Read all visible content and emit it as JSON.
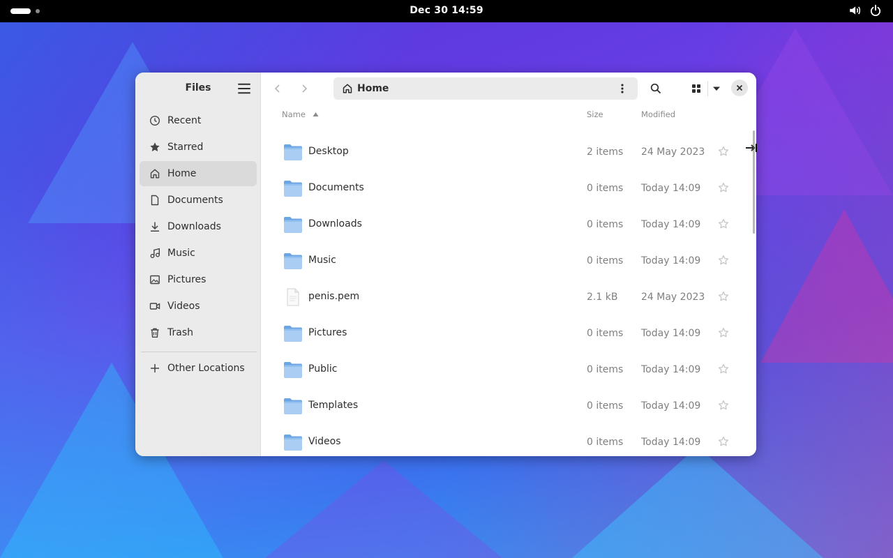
{
  "topbar": {
    "clock": "Dec 30  14:59",
    "icons": [
      "activities-indicator",
      "volume-icon",
      "power-icon"
    ]
  },
  "sidebar": {
    "title": "Files",
    "items": [
      {
        "label": "Recent",
        "icon": "clock-icon"
      },
      {
        "label": "Starred",
        "icon": "star-icon"
      },
      {
        "label": "Home",
        "icon": "home-icon",
        "active": true
      },
      {
        "label": "Documents",
        "icon": "document-icon"
      },
      {
        "label": "Downloads",
        "icon": "download-icon"
      },
      {
        "label": "Music",
        "icon": "music-icon"
      },
      {
        "label": "Pictures",
        "icon": "picture-icon"
      },
      {
        "label": "Videos",
        "icon": "video-icon"
      },
      {
        "label": "Trash",
        "icon": "trash-icon"
      }
    ],
    "other_locations": "Other Locations"
  },
  "header": {
    "path": "Home"
  },
  "columns": {
    "name": "Name",
    "size": "Size",
    "modified": "Modified"
  },
  "files": [
    {
      "name": "Desktop",
      "size": "2 items",
      "modified": "24 May 2023",
      "type": "folder"
    },
    {
      "name": "Documents",
      "size": "0 items",
      "modified": "Today 14:09",
      "type": "folder"
    },
    {
      "name": "Downloads",
      "size": "0 items",
      "modified": "Today 14:09",
      "type": "folder"
    },
    {
      "name": "Music",
      "size": "0 items",
      "modified": "Today 14:09",
      "type": "folder"
    },
    {
      "name": "penis.pem",
      "size": "2.1 kB",
      "modified": "24 May 2023",
      "type": "file"
    },
    {
      "name": "Pictures",
      "size": "0 items",
      "modified": "Today 14:09",
      "type": "folder"
    },
    {
      "name": "Public",
      "size": "0 items",
      "modified": "Today 14:09",
      "type": "folder"
    },
    {
      "name": "Templates",
      "size": "0 items",
      "modified": "Today 14:09",
      "type": "folder"
    },
    {
      "name": "Videos",
      "size": "0 items",
      "modified": "Today 14:09",
      "type": "folder"
    }
  ],
  "colors": {
    "folder": "#6aa6e6",
    "folder_front": "#a9cdf3",
    "sidebar_bg": "#ebebeb",
    "text": "#2e2e2e"
  }
}
